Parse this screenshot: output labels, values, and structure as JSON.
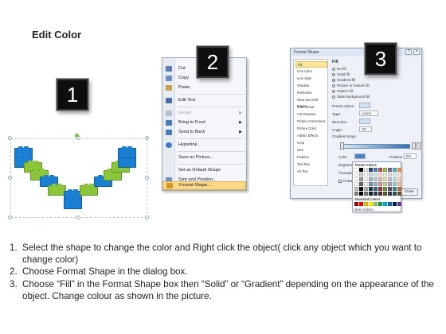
{
  "page": {
    "title": "Edit Color"
  },
  "badges": [
    "1",
    "2",
    "3"
  ],
  "context_menu": {
    "items": [
      {
        "label": "Cut",
        "enabled": true,
        "submenu": false,
        "icon": "scissors-icon",
        "icon_color": "#5a7fb0"
      },
      {
        "label": "Copy",
        "enabled": true,
        "submenu": false,
        "icon": "copy-icon",
        "icon_color": "#6b8fc0"
      },
      {
        "label": "Paste",
        "enabled": true,
        "submenu": false,
        "icon": "clipboard-icon",
        "icon_color": "#c8a04c"
      },
      {
        "label": "Edit Text",
        "enabled": true,
        "submenu": false,
        "icon": "text-edit-icon",
        "icon_color": "#4a6ea5"
      },
      {
        "label": "Group",
        "enabled": false,
        "submenu": true,
        "icon": "group-icon",
        "icon_color": "#b8c0cc"
      },
      {
        "label": "Bring to Front",
        "enabled": true,
        "submenu": true,
        "icon": "bring-front-icon",
        "icon_color": "#4d79b8"
      },
      {
        "label": "Send to Back",
        "enabled": true,
        "submenu": true,
        "icon": "send-back-icon",
        "icon_color": "#4d79b8"
      },
      {
        "label": "Hyperlink...",
        "enabled": true,
        "submenu": false,
        "icon": "hyperlink-icon",
        "icon_color": "#3f78c9"
      },
      {
        "label": "Save as Picture...",
        "enabled": true,
        "submenu": false,
        "icon": "",
        "icon_color": ""
      },
      {
        "label": "Set as Default Shape",
        "enabled": true,
        "submenu": false,
        "icon": "",
        "icon_color": ""
      },
      {
        "label": "Size and Position...",
        "enabled": true,
        "submenu": false,
        "icon": "size-position-icon",
        "icon_color": "#6f8fb8"
      },
      {
        "label": "Format Shape...",
        "enabled": true,
        "submenu": false,
        "highlighted": true,
        "icon": "format-shape-icon",
        "icon_color": "#d9902e"
      }
    ]
  },
  "format_dialog": {
    "title": "Format Shape",
    "sidebar": [
      "Fill",
      "Line Color",
      "Line Style",
      "Shadow",
      "Reflection",
      "Glow and Soft Edges",
      "3-D Format",
      "3-D Rotation",
      "Picture Corrections",
      "Picture Color",
      "Artistic Effects",
      "Crop",
      "Size",
      "Position",
      "Text Box",
      "Alt Text"
    ],
    "selected_sidebar": "Fill",
    "fill_heading": "Fill",
    "fill_options": [
      {
        "label": "No fill",
        "selected": false
      },
      {
        "label": "Solid fill",
        "selected": false
      },
      {
        "label": "Gradient fill",
        "selected": true
      },
      {
        "label": "Picture or texture fill",
        "selected": false
      },
      {
        "label": "Pattern fill",
        "selected": false
      },
      {
        "label": "Slide background fill",
        "selected": false
      }
    ],
    "preset_colors_label": "Preset colors:",
    "type_label": "Type:",
    "type_value": "Linear",
    "direction_label": "Direction:",
    "angle_label": "Angle:",
    "angle_value": "45°",
    "gradient_stops_label": "Gradient stops",
    "color_label": "Color",
    "position_label": "Position:",
    "position_value": "0%",
    "brightness_label": "Brightness:",
    "transparency_label": "Transparency:",
    "rotate_label": "Rotate with shape",
    "close_label": "Close",
    "accent_color": "#2f6fb5"
  },
  "theme_palette": {
    "theme_label": "Theme Colors",
    "standard_label": "Standard Colors",
    "more_label": "More Colors...",
    "theme_top": [
      "#ffffff",
      "#000000",
      "#eeece1",
      "#1f497d",
      "#4f81bd",
      "#c0504d",
      "#9bbb59",
      "#8064a2",
      "#4bacc6",
      "#f79646"
    ],
    "standard": [
      "#c00000",
      "#ff0000",
      "#ffc000",
      "#ffff00",
      "#92d050",
      "#00b050",
      "#00b0f0",
      "#0070c0",
      "#002060",
      "#7030a0"
    ]
  },
  "instructions": [
    {
      "num": "1.",
      "text": "Select the shape to change the color and Right click the object( click any object which you want to change color)"
    },
    {
      "num": "2.",
      "text": "Choose Format Shape in the dialog box."
    },
    {
      "num": "3.",
      "text": "Choose “Fill” in the Format Shape box then “Solid” or “Gradient” depending on the appearance of the object. Change colour as shown in the picture."
    }
  ]
}
